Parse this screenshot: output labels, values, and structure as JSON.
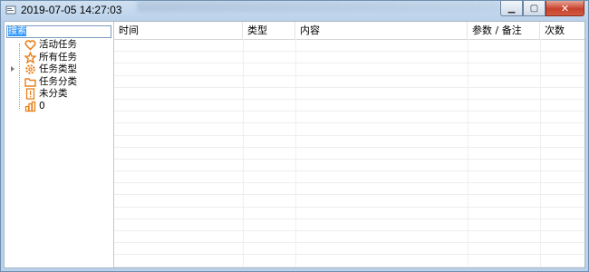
{
  "window": {
    "title": "2019-07-05 14:27:03",
    "minimize_glyph": "▁",
    "maximize_glyph": "▢",
    "close_glyph": "✕"
  },
  "search": {
    "value": "搜索"
  },
  "tree": {
    "items": [
      {
        "label": "活动任务",
        "icon": "heart-icon",
        "expandable": false
      },
      {
        "label": "所有任务",
        "icon": "star-icon",
        "expandable": false
      },
      {
        "label": "任务类型",
        "icon": "gear-icon",
        "expandable": true
      },
      {
        "label": "任务分类",
        "icon": "folder-icon",
        "expandable": false
      },
      {
        "label": "未分类",
        "icon": "exclamation-icon",
        "expandable": false
      },
      {
        "label": "0",
        "icon": "chart-icon",
        "expandable": false
      }
    ],
    "icon_color": "#e8801a"
  },
  "grid": {
    "columns": [
      {
        "label": "时间"
      },
      {
        "label": "类型"
      },
      {
        "label": "内容"
      },
      {
        "label": "参数 / 备注"
      },
      {
        "label": "次数"
      }
    ]
  }
}
